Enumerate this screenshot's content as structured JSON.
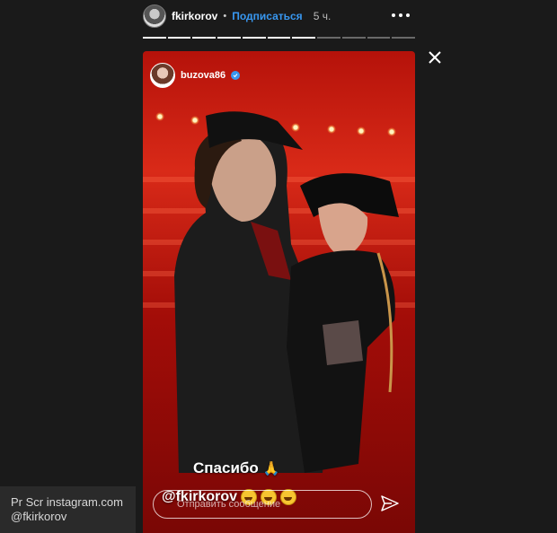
{
  "header": {
    "username": "fkirkorov",
    "separator": "•",
    "follow_label": "Подписаться",
    "time": "5 ч."
  },
  "progress": {
    "segments": 11,
    "completed": 7
  },
  "story": {
    "author": "buzova86",
    "verified": true,
    "caption": "Спасибо",
    "mention": "@fkirkorov",
    "emoji_count": 3,
    "background_color": "#c8170c"
  },
  "reply": {
    "placeholder": "Отправить сообщение"
  },
  "watermark": {
    "line1": "Pr Scr instagram.com",
    "line2": "@fkirkorov"
  },
  "icons": [
    "more-icon",
    "close-icon",
    "verified-icon",
    "pray-icon",
    "laugh-emoji-icon",
    "send-icon"
  ]
}
